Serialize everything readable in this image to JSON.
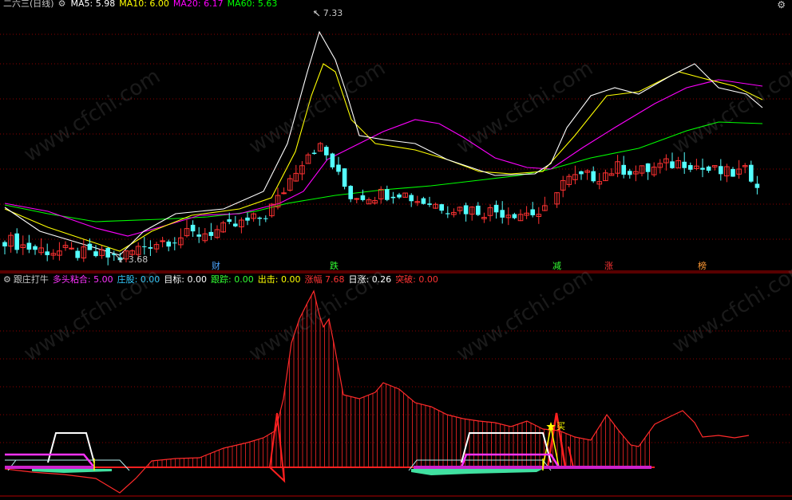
{
  "top_header": {
    "title": "二六三(日线)",
    "ma5": {
      "label": "MA5:",
      "value": "5.98",
      "color": "#ffffff"
    },
    "ma10": {
      "label": "MA10:",
      "value": "6.00",
      "color": "#ffff00"
    },
    "ma20": {
      "label": "MA20:",
      "value": "6.17",
      "color": "#ff00ff"
    },
    "ma60": {
      "label": "MA60:",
      "value": "5.63",
      "color": "#00ff00"
    }
  },
  "price_labels": {
    "high": "7.33",
    "low": "3.68"
  },
  "event_markers": [
    {
      "text": "财",
      "color": "#4da6ff"
    },
    {
      "text": "跌",
      "color": "#33ff33"
    },
    {
      "text": "减",
      "color": "#33ff33"
    },
    {
      "text": "涨",
      "color": "#ff3333"
    },
    {
      "text": "榜",
      "color": "#ff9933"
    }
  ],
  "indicator_header": {
    "name": "跟庄打牛",
    "items": [
      {
        "label": "多头粘合:",
        "value": "5.00",
        "color": "#ff33ff"
      },
      {
        "label": "庄股:",
        "value": "0.00",
        "color": "#33ccff"
      },
      {
        "label": "目标:",
        "value": "0.00",
        "color": "#ffffff"
      },
      {
        "label": "跟踪:",
        "value": "0.00",
        "color": "#33ff33"
      },
      {
        "label": "出击:",
        "value": "0.00",
        "color": "#ffff00"
      },
      {
        "label": "涨幅",
        "value": "7.68",
        "color": "#ff3333"
      },
      {
        "label": "日涨:",
        "value": "0.26",
        "color": "#ffffff"
      },
      {
        "label": "突破:",
        "value": "0.00",
        "color": "#ff3333"
      }
    ]
  },
  "buy_label": "买",
  "watermark": "www.cfchi.com",
  "colors": {
    "up": "#ff3232",
    "down": "#54ffff",
    "grid": "#8b0000",
    "ma5": "#ffffff",
    "ma10": "#ffff00",
    "ma20": "#ff00ff",
    "ma60": "#00ff00"
  },
  "chart_data": {
    "type": "candlestick",
    "price_range": [
      3.5,
      7.5
    ],
    "high": 7.33,
    "low": 3.68
  }
}
